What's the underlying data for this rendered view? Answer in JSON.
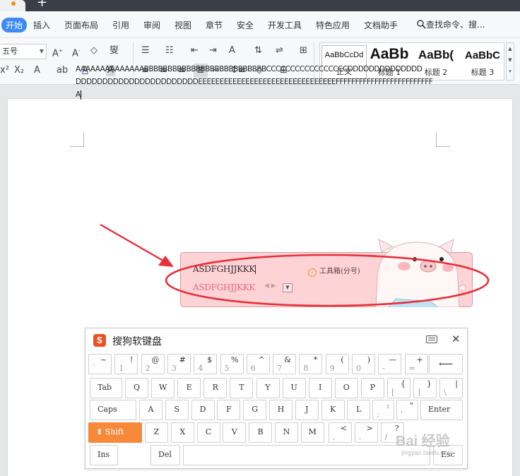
{
  "menu": {
    "items": [
      "开始",
      "插入",
      "页面布局",
      "引用",
      "审阅",
      "视图",
      "章节",
      "安全",
      "开发工具",
      "特色应用",
      "文档助手"
    ],
    "search_label": "查找命令、搜..."
  },
  "ribbon": {
    "font_size_value": "五号",
    "styles": [
      {
        "preview": "AaBbCcDd",
        "name": "正文"
      },
      {
        "preview": "AaBb",
        "name": "标题 1"
      },
      {
        "preview": "AaBb(",
        "name": "标题 2"
      },
      {
        "preview": "AaBbC",
        "name": "标题 3"
      }
    ]
  },
  "document": {
    "line1": "AAAAAAAAAAAAAABBBBBBBBBBBBBBBBBBBBBBBBBBCCCCCCCCCCCCCCCCCDDDDDDDDDDDDDD",
    "line2": "DDDDDDDDDDDDDDDDDDDDDDDEEEEEEEEEEEEEEEEEEEEEEEEEEEEEEEEFFFFFFFFFFFFFFFFFFFFFFFFFA"
  },
  "ime": {
    "pinyin": "ASDFGHJJKKK",
    "candidate": "ASDFGHJJKKK",
    "toolbox_label": "工具箱(分号)"
  },
  "keyboard": {
    "title": "搜狗软键盘",
    "row1": [
      {
        "up": "~",
        "dn": "`"
      },
      {
        "up": "!",
        "dn": "1"
      },
      {
        "up": "@",
        "dn": "2"
      },
      {
        "up": "#",
        "dn": "3"
      },
      {
        "up": "$",
        "dn": "4"
      },
      {
        "up": "%",
        "dn": "5"
      },
      {
        "up": "^",
        "dn": "6"
      },
      {
        "up": "&",
        "dn": "7"
      },
      {
        "up": "*",
        "dn": "8"
      },
      {
        "up": "(",
        "dn": "9"
      },
      {
        "up": ")",
        "dn": "0"
      },
      {
        "up": "—",
        "dn": "-"
      },
      {
        "up": "+",
        "dn": "="
      }
    ],
    "backspace": "⟵",
    "tab": "Tab",
    "row2": [
      "Q",
      "W",
      "E",
      "R",
      "T",
      "Y",
      "U",
      "I",
      "O",
      "P"
    ],
    "row2_sym": [
      {
        "up": "{",
        "dn": "["
      },
      {
        "up": "}",
        "dn": "]"
      },
      {
        "up": "|",
        "dn": "\\"
      }
    ],
    "caps": "Caps",
    "row3": [
      "A",
      "S",
      "D",
      "F",
      "G",
      "H",
      "J",
      "K",
      "L"
    ],
    "row3_sym": [
      {
        "up": ":",
        "dn": ";"
      },
      {
        "up": "\"",
        "dn": "'"
      }
    ],
    "enter": "Enter",
    "shift": "Shift",
    "row4": [
      "Z",
      "X",
      "C",
      "V",
      "B",
      "N",
      "M"
    ],
    "row4_sym": [
      {
        "up": "<",
        "dn": ","
      },
      {
        "up": ">",
        "dn": "."
      },
      {
        "up": "?",
        "dn": "/"
      }
    ],
    "ins": "Ins",
    "del": "Del",
    "esc": "Esc"
  },
  "watermark": {
    "text": "Bai 经验",
    "sub": "jingyan.baidu.com"
  },
  "colors": {
    "accent": "#3d8af7",
    "shift_key": "#f7893a",
    "ime_bg": "#fdd3d6",
    "arrow_red": "#e8303a",
    "ellipse_red": "#e8303a"
  }
}
